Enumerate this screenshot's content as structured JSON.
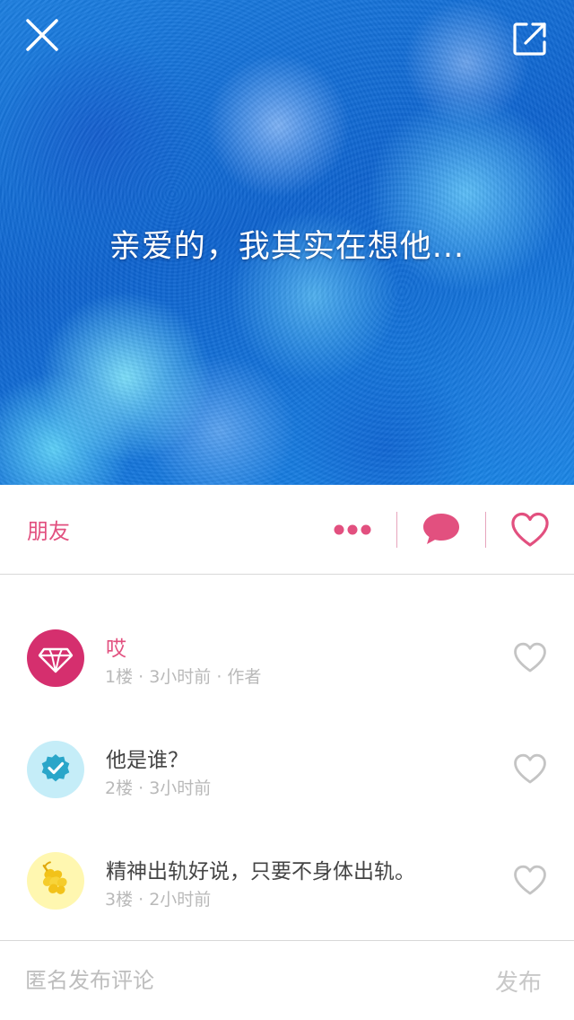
{
  "post": {
    "text": "亲爱的，我其实在想他...",
    "category": "朋友"
  },
  "actions": {
    "more_icon": "ellipsis-icon",
    "comment_icon": "speech-bubble-icon",
    "like_icon": "heart-outline-icon"
  },
  "comments": [
    {
      "text": "哎",
      "meta": "1楼 · 3小时前 · 作者",
      "avatar_icon": "diamond-icon",
      "avatar_color": "#d52f6e",
      "is_author": true
    },
    {
      "text": "他是谁？",
      "meta": "2楼 · 3小时前",
      "avatar_icon": "verified-badge-icon",
      "avatar_color": "#c5edf8",
      "is_author": false
    },
    {
      "text": "精神出轨好说，只要不身体出轨。",
      "meta": "3楼 · 2小时前",
      "avatar_icon": "hop-cone-icon",
      "avatar_color": "#fff7b0",
      "is_author": false
    }
  ],
  "composer": {
    "placeholder": "匿名发布评论",
    "value": "",
    "submit_label": "发布"
  },
  "colors": {
    "accent": "#e2507f",
    "hero_blue": "#0e63cf",
    "divider": "#d8d8d8",
    "meta_text": "#b9b9b9"
  }
}
